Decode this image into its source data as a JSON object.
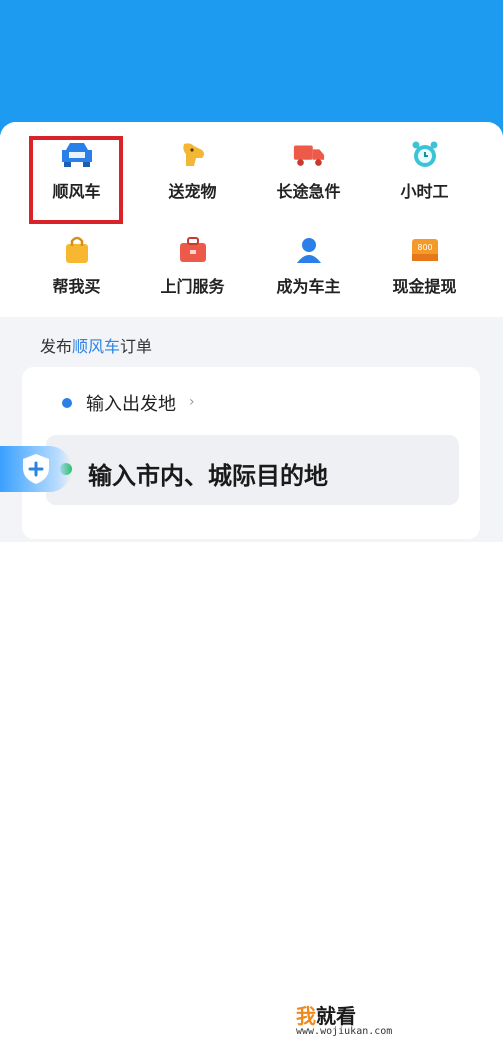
{
  "colors": {
    "header_blue": "#1c9bf0",
    "highlight_red": "#d9232b",
    "accent_blue": "#2a84e6",
    "origin_dot": "#2a7fe8",
    "dest_dot": "#2ec06a"
  },
  "services": [
    {
      "label": "顺风车",
      "icon": "car-icon",
      "highlighted": true
    },
    {
      "label": "送宠物",
      "icon": "dog-icon"
    },
    {
      "label": "长途急件",
      "icon": "truck-icon"
    },
    {
      "label": "小时工",
      "icon": "alarm-clock-icon"
    },
    {
      "label": "帮我买",
      "icon": "shopping-bag-icon"
    },
    {
      "label": "上门服务",
      "icon": "toolbox-icon"
    },
    {
      "label": "成为车主",
      "icon": "driver-icon"
    },
    {
      "label": "现金提现",
      "icon": "cash-icon",
      "badge": "800"
    }
  ],
  "section": {
    "prefix": "发布",
    "accent": "顺风车",
    "suffix": "订单"
  },
  "origin": {
    "placeholder": "输入出发地",
    "chevron": "›"
  },
  "destination": {
    "placeholder": "输入市内、城际目的地"
  },
  "watermark": {
    "wo": "我",
    "rest": "就看",
    "url": "www.wojiukan.com"
  }
}
